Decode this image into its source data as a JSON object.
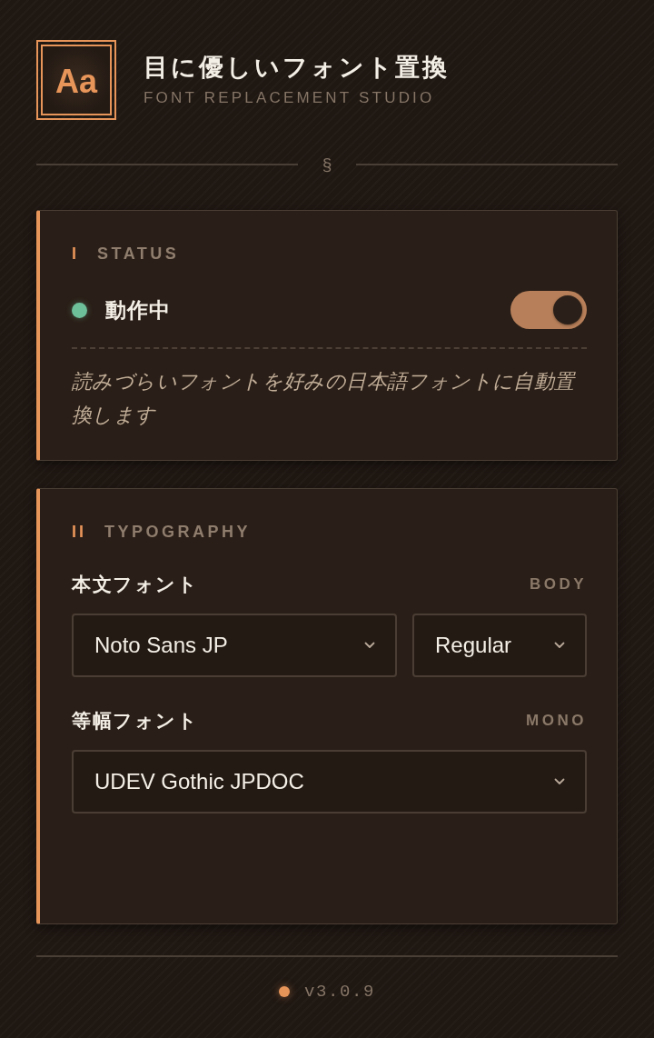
{
  "header": {
    "logo": "Aa",
    "title": "目に優しいフォント置換",
    "subtitle": "FONT REPLACEMENT STUDIO"
  },
  "divider": {
    "symbol": "§"
  },
  "status_panel": {
    "numeral": "I",
    "heading": "STATUS",
    "state_label": "動作中",
    "on": true,
    "description": "読みづらいフォントを好みの日本語フォントに自動置換します"
  },
  "typography_panel": {
    "numeral": "II",
    "heading": "TYPOGRAPHY",
    "fields": [
      {
        "label": "本文フォント",
        "tag": "BODY",
        "selects": [
          {
            "value": "Noto Sans JP"
          },
          {
            "value": "Regular"
          }
        ]
      },
      {
        "label": "等幅フォント",
        "tag": "MONO",
        "selects": [
          {
            "value": "UDEV Gothic JPDOC"
          }
        ]
      }
    ]
  },
  "footer": {
    "version": "v3.0.9"
  }
}
